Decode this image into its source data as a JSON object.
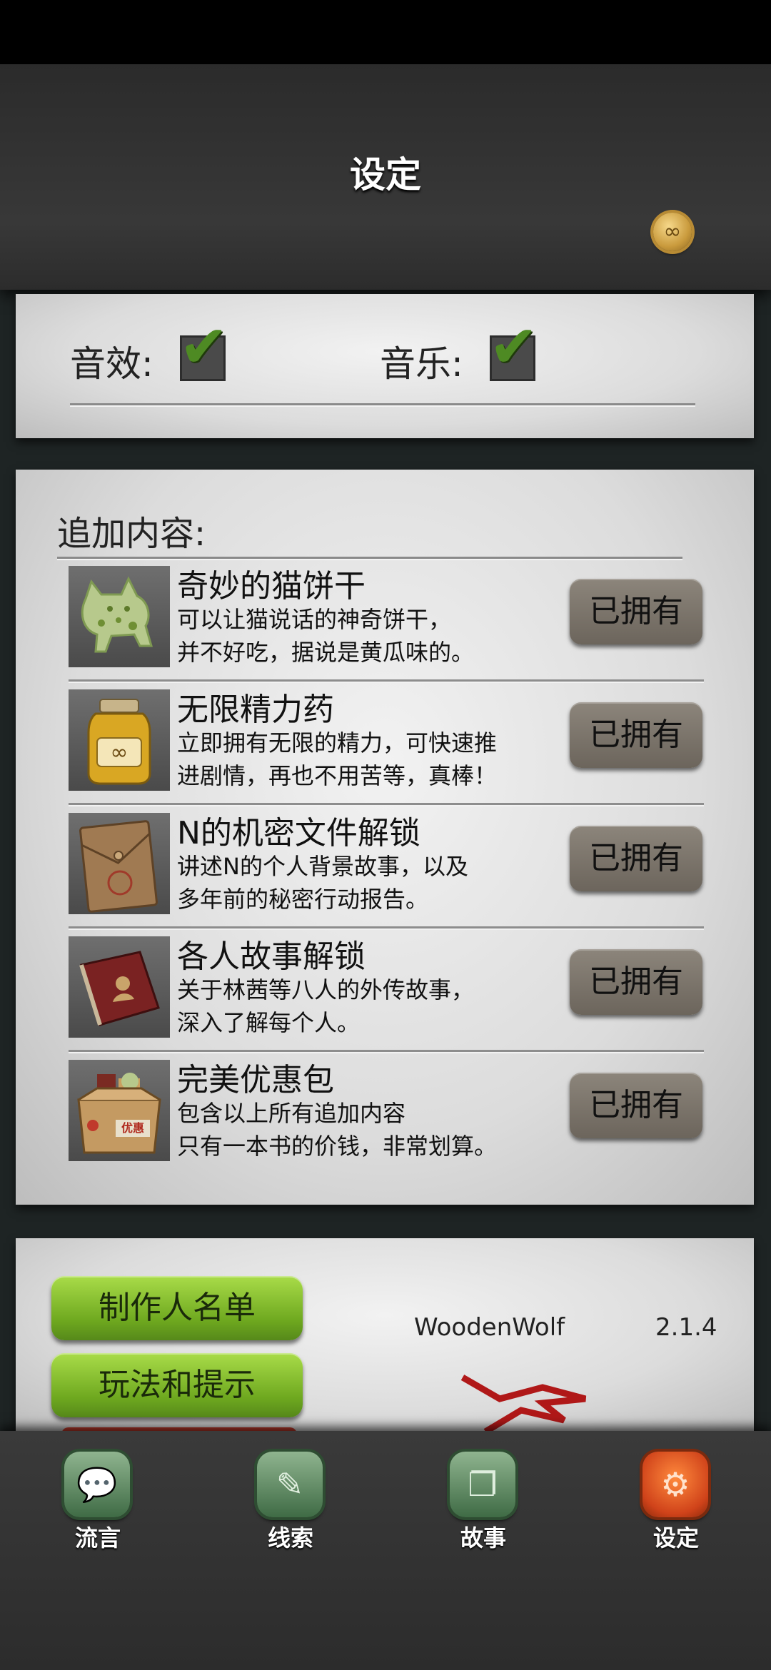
{
  "header": {
    "title": "设定",
    "coin_icon": "coin-icon"
  },
  "settings": {
    "sound": {
      "label": "音效:",
      "checked": true
    },
    "music": {
      "label": "音乐:",
      "checked": true
    }
  },
  "dlc": {
    "title": "追加内容:",
    "items": [
      {
        "name": "奇妙的猫饼干",
        "desc1": "可以让猫说话的神奇饼干，",
        "desc2": "并不好吃，据说是黄瓜味的。",
        "button": "已拥有",
        "icon": "cat-cookie-icon"
      },
      {
        "name": "无限精力药",
        "desc1": "立即拥有无限的精力，可快速推",
        "desc2": "进剧情，再也不用苦等，真棒！",
        "button": "已拥有",
        "icon": "potion-jar-icon"
      },
      {
        "name": "N的机密文件解锁",
        "desc1": "讲述N的个人背景故事，以及",
        "desc2": "多年前的秘密行动报告。",
        "button": "已拥有",
        "icon": "envelope-icon"
      },
      {
        "name": "各人故事解锁",
        "desc1": "关于林茜等八人的外传故事，",
        "desc2": "深入了解每个人。",
        "button": "已拥有",
        "icon": "book-icon"
      },
      {
        "name": "完美优惠包",
        "desc1": "包含以上所有追加内容",
        "desc2": "只有一本书的价钱，非常划算。",
        "button": "已拥有",
        "icon": "gift-box-icon",
        "box_text": "优惠"
      }
    ]
  },
  "about": {
    "credits_button": "制作人名单",
    "help_button": "玩法和提示",
    "developer": "WoodenWolf",
    "version": "2.1.4"
  },
  "tabs": [
    {
      "label": "流言",
      "icon": "chat-bubble-icon",
      "active": false
    },
    {
      "label": "线索",
      "icon": "paper-note-icon",
      "active": false
    },
    {
      "label": "故事",
      "icon": "storybook-icon",
      "active": false
    },
    {
      "label": "设定",
      "icon": "gear-icon",
      "active": true
    }
  ],
  "colors": {
    "tab_active": "#d0431a",
    "button_green": "#6ea81f",
    "owned_button": "#7a736a"
  }
}
